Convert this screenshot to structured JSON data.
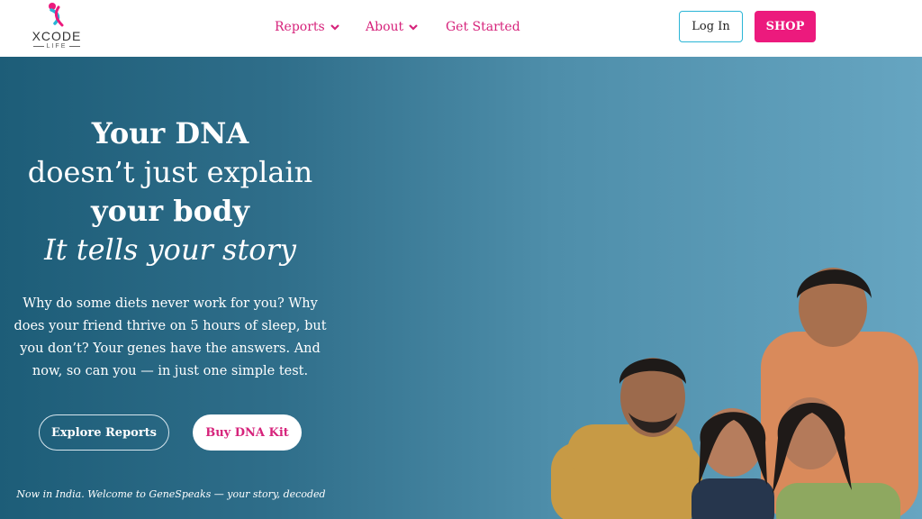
{
  "brand": {
    "name": "XCODE",
    "sub": "LIFE",
    "colors": {
      "primary": "#ec1a7d",
      "accent": "#2ab5d6",
      "hero_start": "#1d5d78",
      "hero_end": "#66a5c1"
    }
  },
  "nav": {
    "items": [
      {
        "label": "Reports",
        "icon": "chevron-down-icon"
      },
      {
        "label": "About",
        "icon": "chevron-down-icon"
      },
      {
        "label": "Get Started"
      }
    ]
  },
  "header_actions": {
    "login_label": "Log In",
    "shop_label": "SHOP"
  },
  "hero": {
    "headline": {
      "line1": "Your DNA",
      "line2": "doesn’t just explain",
      "line3": "your body",
      "line4": "It tells your story"
    },
    "description": "Why do some diets never work for you? Why does your friend thrive on 5 hours of sleep, but you don’t? Your genes have the answers. And now, so can you — in just one simple test.",
    "explore_label": "Explore Reports",
    "buy_label": "Buy DNA Kit",
    "tagline": "Now in India. Welcome to GeneSpeaks — your story, decoded",
    "image": "family-photo"
  }
}
